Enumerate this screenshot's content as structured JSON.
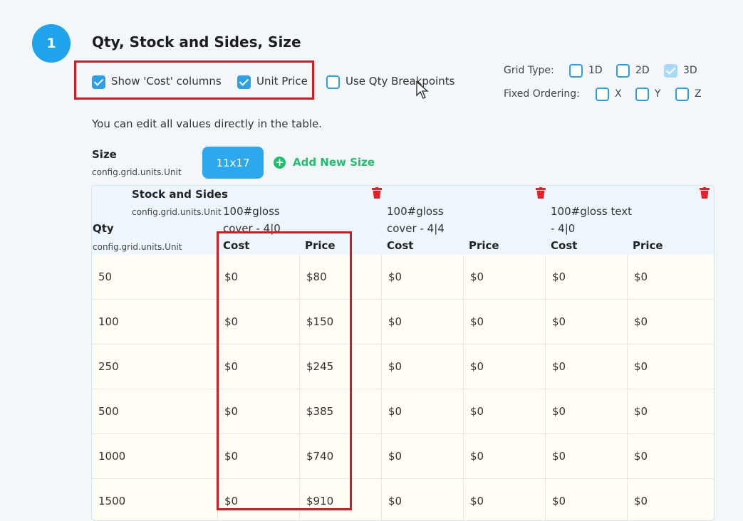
{
  "step": {
    "number": "1",
    "title": "Qty, Stock and Sides, Size"
  },
  "options": {
    "show_cost": {
      "label": "Show 'Cost' columns",
      "checked": true
    },
    "unit_price": {
      "label": "Unit Price",
      "checked": true
    },
    "use_qty_breakpoints": {
      "label": "Use Qty Breakpoints",
      "checked": false
    }
  },
  "grid_type": {
    "label": "Grid Type:",
    "options": [
      {
        "label": "1D",
        "checked": false
      },
      {
        "label": "2D",
        "checked": false
      },
      {
        "label": "3D",
        "checked": true
      }
    ]
  },
  "fixed_ordering": {
    "label": "Fixed Ordering:",
    "options": [
      {
        "label": "X",
        "checked": false
      },
      {
        "label": "Y",
        "checked": false
      },
      {
        "label": "Z",
        "checked": false
      }
    ]
  },
  "hint": "You can edit all values directly in the table.",
  "size": {
    "label": "Size",
    "unit": "config.grid.units.Unit",
    "current": "11x17",
    "add_label": "Add New Size"
  },
  "table": {
    "stock_label": "Stock and Sides",
    "stock_unit": "config.grid.units.Unit",
    "qty_label": "Qty",
    "qty_unit": "config.grid.units.Unit",
    "stocks": [
      {
        "line1": "100#gloss",
        "line2": "cover - 4|0"
      },
      {
        "line1": "100#gloss",
        "line2": "cover - 4|4"
      },
      {
        "line1": "100#gloss text",
        "line2": "- 4|0"
      }
    ],
    "columns": [
      "Cost",
      "Price",
      "Cost",
      "Price",
      "Cost",
      "Price"
    ],
    "rows": [
      {
        "qty": "50",
        "values": [
          "$0",
          "$80",
          "$0",
          "$0",
          "$0",
          "$0"
        ]
      },
      {
        "qty": "100",
        "values": [
          "$0",
          "$150",
          "$0",
          "$0",
          "$0",
          "$0"
        ]
      },
      {
        "qty": "250",
        "values": [
          "$0",
          "$245",
          "$0",
          "$0",
          "$0",
          "$0"
        ]
      },
      {
        "qty": "500",
        "values": [
          "$0",
          "$385",
          "$0",
          "$0",
          "$0",
          "$0"
        ]
      },
      {
        "qty": "1000",
        "values": [
          "$0",
          "$740",
          "$0",
          "$0",
          "$0",
          "$0"
        ]
      },
      {
        "qty": "1500",
        "values": [
          "$0",
          "$910",
          "$0",
          "$0",
          "$0",
          "$0"
        ]
      }
    ]
  },
  "colors": {
    "accent": "#2ba0e6",
    "highlight": "#d6191f",
    "add": "#1cc06a",
    "cell_bg": "#fffdf4",
    "head_bg": "#eef7fd"
  }
}
